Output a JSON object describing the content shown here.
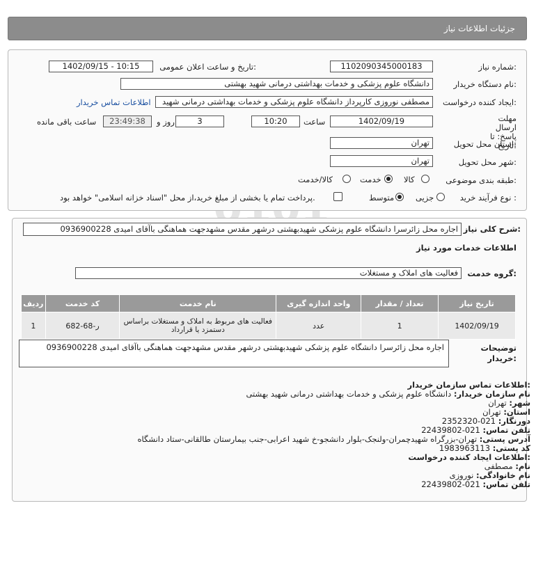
{
  "header": {
    "title": "جزئیات اطلاعات نیاز"
  },
  "form": {
    "need_number_label": "شماره نیاز:",
    "need_number": "1102090345000183",
    "announce_label": "تاریخ و ساعت اعلان عمومی:",
    "announce_value": "1402/09/15 - 10:15",
    "buyer_label": "نام دستگاه خریدار:",
    "buyer_value": "دانشگاه علوم پزشکی و خدمات بهداشتی درمانی شهید بهشتی",
    "creator_label": "ایجاد کننده درخواست:",
    "creator_value": "مصطفی نوروزی کارپرداز دانشگاه علوم پزشکی و خدمات بهداشتی درمانی شهید",
    "contact_link": "اطلاعات تماس خریدار",
    "deadline_label": "مهلت ارسال پاسخ: تا تاریخ:",
    "deadline_date": "1402/09/19",
    "time_label": "ساعت",
    "deadline_time": "10:20",
    "days_value": "3",
    "days_label": "روز و",
    "remaining_time": "23:49:38",
    "remaining_label": "ساعت باقی مانده",
    "province_label": "استان محل تحویل:",
    "province_value": "تهران",
    "city_label": "شهر محل تحویل:",
    "city_value": "تهران",
    "category_label": "طبقه بندی موضوعی:",
    "category_options": [
      "کالا",
      "خدمت",
      "کالا/خدمت"
    ],
    "category_selected": "خدمت",
    "process_label": "نوع فرآیند خرید :",
    "process_options": [
      "جزیی",
      "متوسط"
    ],
    "process_selected": "متوسط",
    "payment_note": "پرداخت تمام یا بخشی از مبلغ خرید،از محل \"اسناد خزانه اسلامی\" خواهد بود."
  },
  "description": {
    "label": "شرح کلی نیاز:",
    "text": "اجاره محل زائرسرا دانشگاه علوم پزشکی شهیدبهشتی درشهر مقدس مشهدجهت هماهنگی باآقای امیدی 0936900228"
  },
  "services": {
    "section_title": "اطلاعات خدمات مورد نیاز",
    "group_label": "گروه خدمت:",
    "group_value": "فعالیت های  املاک و مستغلات",
    "columns": [
      "ردیف",
      "کد خدمت",
      "نام خدمت",
      "واحد اندازه گیری",
      "تعداد / مقدار",
      "تاریخ نیاز"
    ],
    "rows": [
      {
        "index": "1",
        "code": "ر-68-682",
        "name": "فعالیت های مربوط به املاک و مستغلات براساس دستمزد یا قرارداد",
        "unit": "عدد",
        "qty": "1",
        "date": "1402/09/19"
      }
    ]
  },
  "buyer_notes": {
    "label": "توضیحات خریدار:",
    "text": "اجاره محل زائرسرا دانشگاه علوم پزشکی شهیدبهشتی درشهر مقدس مشهدجهت هماهنگی باآقای امیدی 0936900228"
  },
  "org_contact": {
    "title": "اطلاعات تماس سازمان خریدار:",
    "org_label": "نام سازمان خریدار:",
    "org_value": "دانشگاه علوم پزشکی و خدمات بهداشتی درمانی شهید بهشتی",
    "city_label": "شهر:",
    "city_value": "تهران",
    "province_label": "استان:",
    "province_value": "تهران",
    "fax_label": "دورنگار:",
    "fax_value": "021-2352320",
    "phone_label": "تلفن تماس:",
    "phone_value": "021-22439802",
    "address_label": "آدرس پستی:",
    "address_value": "تهران-بزرگراه شهیدچمران-ولنجک-بلوار دانشجو-خ شهید اعرابی-جنب بیمارستان طالقانی-ستاد دانشگاه",
    "postal_label": "کد پستی:",
    "postal_value": "1983963113"
  },
  "creator_contact": {
    "title": "اطلاعات ایجاد کننده درخواست:",
    "name_label": "نام:",
    "name_value": "مصطفی",
    "family_label": "نام خانوادگی:",
    "family_value": "نوروزی",
    "phone_label": "تلفن تماس:",
    "phone_value": "021-22439802"
  },
  "watermark": {
    "brand": "ParsNamadData",
    "tagline": "پایگاه اطلاع رسانی مناقصه و مزایده",
    "phone": "۰۲۱-۸۸۳۴۹۶۷۰-۵"
  }
}
